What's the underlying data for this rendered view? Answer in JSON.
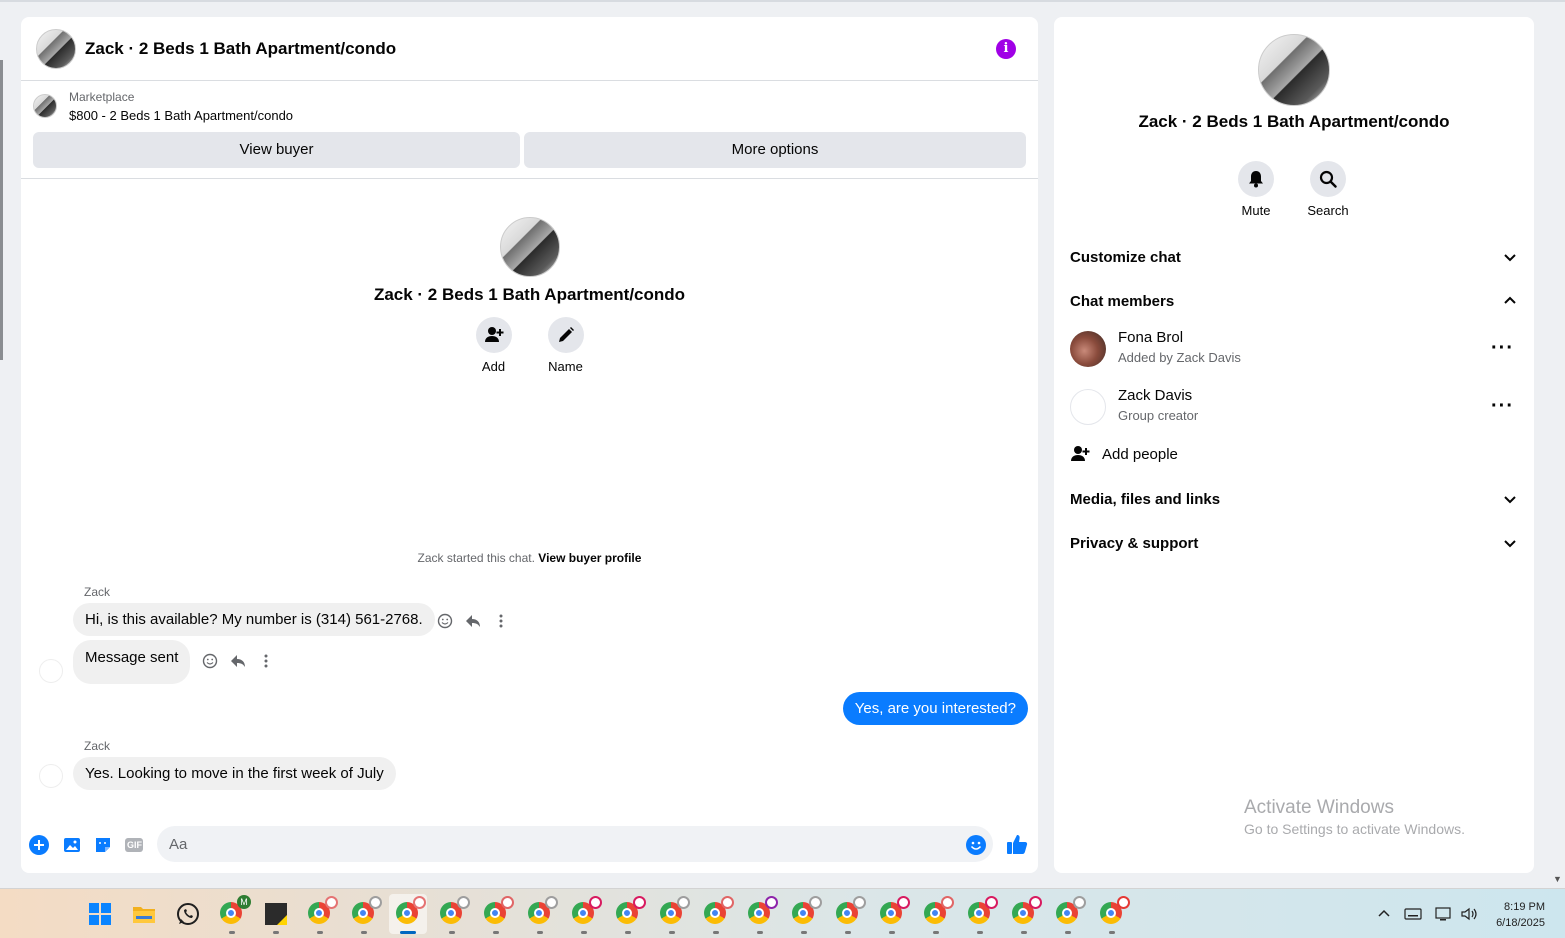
{
  "chat": {
    "title": "Zack · 2 Beds 1 Bath Apartment/condo",
    "marketplace_label": "Marketplace",
    "listing": "$800 - 2 Beds 1 Bath Apartment/condo",
    "view_buyer_label": "View buyer",
    "more_options_label": "More options",
    "center_title": "Zack · 2 Beds 1 Bath Apartment/condo",
    "add_label": "Add",
    "name_label": "Name",
    "started_text": "Zack started this chat.",
    "view_buyer_profile": "View buyer profile",
    "messages": [
      {
        "sender": "Zack",
        "text": "Hi, is this available? My number is (314) 561-2768."
      },
      {
        "text": "Message sent"
      },
      {
        "text": "Yes, are you interested?"
      },
      {
        "sender": "Zack",
        "text": "Yes. Looking to move in the first week of July"
      }
    ],
    "composer_placeholder": "Aa",
    "gif_label": "GIF"
  },
  "side": {
    "title": "Zack · 2 Beds 1 Bath Apartment/condo",
    "mute_label": "Mute",
    "search_label": "Search",
    "customize_chat": "Customize chat",
    "chat_members": "Chat members",
    "members": [
      {
        "name": "Fona Brol",
        "sub": "Added by Zack Davis"
      },
      {
        "name": "Zack Davis",
        "sub": "Group creator"
      }
    ],
    "add_people": "Add people",
    "media_files_links": "Media, files and links",
    "privacy_support": "Privacy & support"
  },
  "watermark": {
    "title": "Activate Windows",
    "subtitle": "Go to Settings to activate Windows."
  },
  "taskbar": {
    "time": "8:19 PM",
    "date": "6/18/2025",
    "gmail_badge": "M"
  },
  "colors": {
    "accent_blue": "#0a7cff",
    "info_purple": "#a000e6",
    "bubble_gray": "#f0f0f0"
  }
}
